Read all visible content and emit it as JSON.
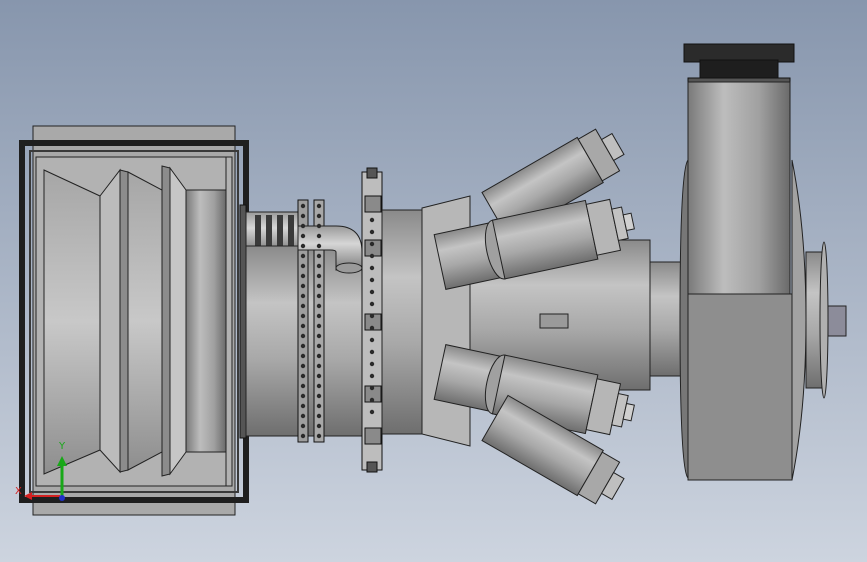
{
  "viewport": {
    "background_top": "#8796ad",
    "background_bottom": "#cdd4df"
  },
  "triad": {
    "x_label": "X",
    "y_label": "Y",
    "x_color": "#d42020",
    "y_color": "#18a818",
    "z_color": "#2030c8"
  },
  "model": {
    "body_color": "#9c9c9c",
    "edge_color": "#1a1a1a",
    "dark_color": "#2a2a2a"
  }
}
